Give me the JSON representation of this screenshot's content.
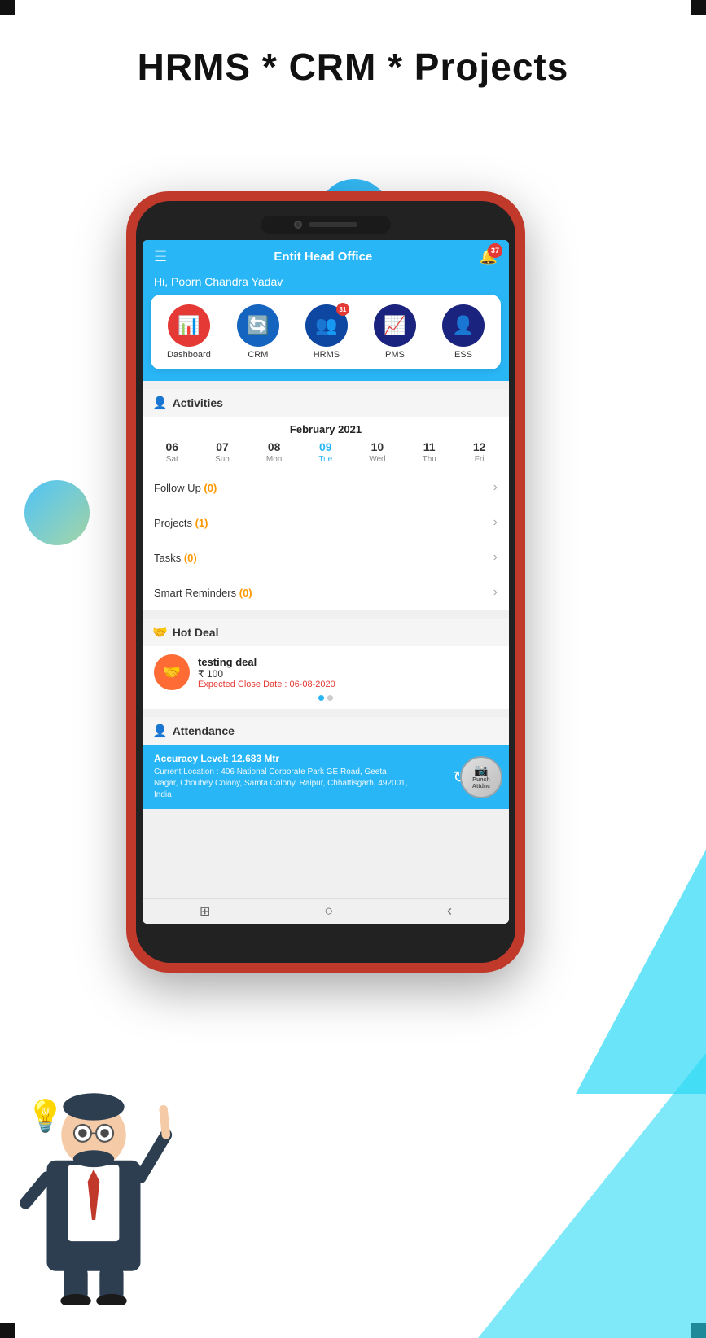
{
  "page": {
    "title": "HRMS * CRM * Projects"
  },
  "header": {
    "office_name": "Entit Head Office",
    "notification_count": "37",
    "greeting": "Hi,  Poorn Chandra Yadav"
  },
  "modules": [
    {
      "id": "dashboard",
      "label": "Dashboard",
      "color": "red",
      "badge": null,
      "icon": "📊"
    },
    {
      "id": "crm",
      "label": "CRM",
      "color": "blue",
      "badge": null,
      "icon": "🔄"
    },
    {
      "id": "hrms",
      "label": "HRMS",
      "color": "dark-blue",
      "badge": "31",
      "icon": "👥"
    },
    {
      "id": "pms",
      "label": "PMS",
      "color": "navy",
      "badge": null,
      "icon": "📈"
    },
    {
      "id": "ess",
      "label": "ESS",
      "color": "navy",
      "badge": null,
      "icon": "👤"
    }
  ],
  "activities": {
    "section_title": "Activities",
    "calendar": {
      "month_year": "February 2021",
      "days": [
        {
          "num": "06",
          "label": "Sat",
          "active": false
        },
        {
          "num": "07",
          "label": "Sun",
          "active": false
        },
        {
          "num": "08",
          "label": "Mon",
          "active": false
        },
        {
          "num": "09",
          "label": "Tue",
          "active": true
        },
        {
          "num": "10",
          "label": "Wed",
          "active": false
        },
        {
          "num": "11",
          "label": "Thu",
          "active": false
        },
        {
          "num": "12",
          "label": "Fri",
          "active": false
        }
      ]
    },
    "items": [
      {
        "label": "Follow Up",
        "count": "(0)",
        "count_color": "orange"
      },
      {
        "label": "Projects",
        "count": "(1)",
        "count_color": "orange"
      },
      {
        "label": "Tasks",
        "count": "(0)",
        "count_color": "orange"
      },
      {
        "label": "Smart Reminders",
        "count": "(0)",
        "count_color": "orange"
      }
    ]
  },
  "hot_deal": {
    "section_title": "Hot Deal",
    "deal_name": "testing deal",
    "deal_amount": "₹ 100",
    "expected_close": "Expected Close Date : 06-08-2020"
  },
  "attendance": {
    "section_title": "Attendance",
    "accuracy_label": "Accuracy Level: 12.683 Mtr",
    "location_label": "Current Location : 406 National Corporate Park GE Road, Geeta Nagar, Choubey Colony, Samta Colony, Raipur, Chhattisgarh, 492001, India",
    "punch_label": "Punch\nAttendance"
  },
  "nav": {
    "menu_icon": "☰",
    "bell_icon": "🔔",
    "home_icon": "⊙",
    "back_icon": "‹"
  }
}
